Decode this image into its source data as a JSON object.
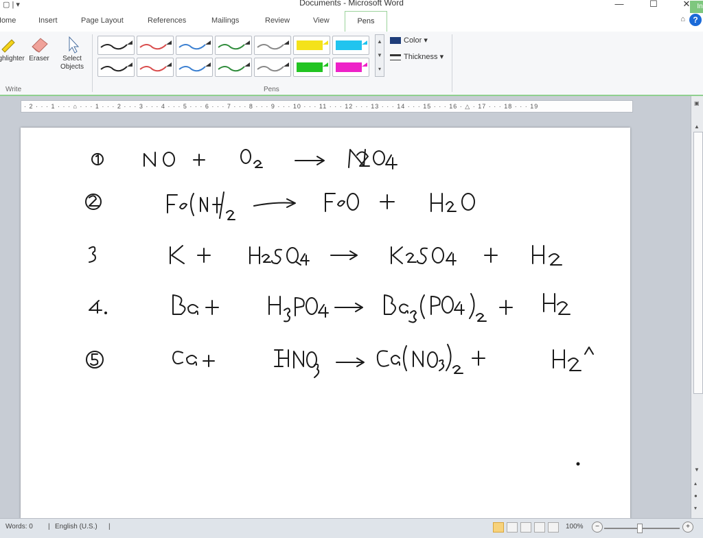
{
  "titlebar": {
    "title": "Documents - Microsoft Word",
    "minimize": "—",
    "maximize": "☐",
    "close": "✕"
  },
  "tabs": [
    {
      "label": "Home"
    },
    {
      "label": "Insert"
    },
    {
      "label": "Page Layout"
    },
    {
      "label": "References"
    },
    {
      "label": "Mailings"
    },
    {
      "label": "Review"
    },
    {
      "label": "View"
    },
    {
      "label": "Pens"
    }
  ],
  "contextual_tab": "Ink Tools",
  "ribbon": {
    "write_group": {
      "label": "Write",
      "tools": [
        {
          "label": "Highlighter",
          "icon": "highlighter-icon"
        },
        {
          "label": "Eraser",
          "icon": "eraser-icon"
        },
        {
          "label": "Select Objects",
          "icon": "cursor-icon"
        }
      ]
    },
    "pens_group": {
      "label": "Pens",
      "pens_row1": [
        "#222222",
        "#d94b4b",
        "#3a7fd1",
        "#2e8b3a",
        "#888888",
        "#f4e21a",
        "#21c4ef"
      ],
      "pens_row2": [
        "#222222",
        "#d94b4b",
        "#3a7fd1",
        "#2e8b3a",
        "#888888",
        "#22c422",
        "#ee22c8"
      ],
      "color_label": "Color",
      "thickness_label": "Thickness"
    }
  },
  "ruler_text": "· 2 · · · 1 · · · ⌂ · · · 1 · · · 2 · · · 3 · · · 4 · · · 5 · · · 6 · · · 7 · · · 8 · · · 9 · · · 10 · · · 11 · · · 12 · · · 13 · · · 14 · · · 15 · · · 16 · △ · 17 · · · 18 · · · 19",
  "status": {
    "words": "Words: 0",
    "language": "English (U.S.)",
    "zoom": "100%"
  }
}
